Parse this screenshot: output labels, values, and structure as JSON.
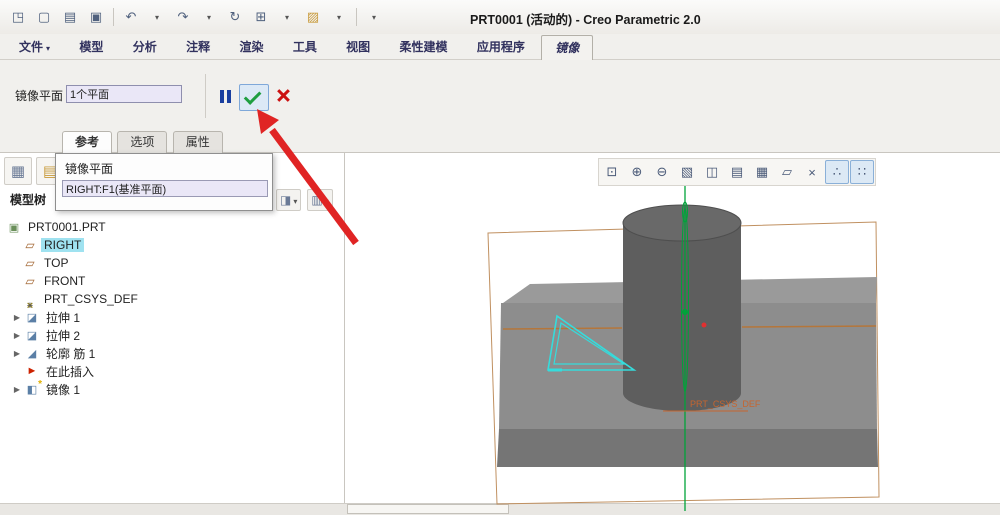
{
  "colors": {
    "check_green": "#1f9e40",
    "cancel_red": "#cc1111",
    "pause_blue": "#1a3fa0",
    "selection_cyan": "#9fe2f0",
    "datum_orange": "#b5763a",
    "axis_green": "#00a33a",
    "sketch_cyan": "#35dcdc",
    "arrow_red": "#e02424"
  },
  "title_bar": {
    "title": "PRT0001 (活动的) - Creo Parametric 2.0",
    "icons": [
      {
        "name": "window-icon",
        "glyph": "◳"
      },
      {
        "name": "new-file-icon",
        "glyph": "▢"
      },
      {
        "name": "open-icon",
        "glyph": "▤"
      },
      {
        "name": "save-icon",
        "glyph": "▣"
      },
      {
        "name": "undo-icon",
        "glyph": "↶"
      },
      {
        "name": "redo-icon",
        "glyph": "↷"
      },
      {
        "name": "regenerate-icon",
        "glyph": "↻"
      },
      {
        "name": "windows-icon",
        "glyph": "⊞"
      },
      {
        "name": "recent-folder-icon",
        "glyph": "▨"
      }
    ]
  },
  "ribbon": {
    "tabs": [
      {
        "label": "文件",
        "active": false
      },
      {
        "label": "模型",
        "active": false
      },
      {
        "label": "分析",
        "active": false
      },
      {
        "label": "注释",
        "active": false
      },
      {
        "label": "渲染",
        "active": false
      },
      {
        "label": "工具",
        "active": false
      },
      {
        "label": "视图",
        "active": false
      },
      {
        "label": "柔性建模",
        "active": false
      },
      {
        "label": "应用程序",
        "active": false
      },
      {
        "label": "镜像",
        "active": true
      }
    ]
  },
  "dashboard": {
    "mirror_plane_label": "镜像平面",
    "mirror_plane_value": "1个平面"
  },
  "subtabs": [
    {
      "label": "参考",
      "active": true
    },
    {
      "label": "选项",
      "active": false
    },
    {
      "label": "属性",
      "active": false
    }
  ],
  "reference_panel": {
    "label": "镜像平面",
    "value": "RIGHT:F1(基准平面)"
  },
  "model_tree": {
    "title": "模型树",
    "items": [
      {
        "label": "PRT0001.PRT",
        "icon": "part"
      },
      {
        "label": "RIGHT",
        "icon": "datum-plane",
        "selected": true
      },
      {
        "label": "TOP",
        "icon": "datum-plane"
      },
      {
        "label": "FRONT",
        "icon": "datum-plane"
      },
      {
        "label": "PRT_CSYS_DEF",
        "icon": "csys"
      },
      {
        "label": "拉伸 1",
        "icon": "extrude",
        "expandable": true
      },
      {
        "label": "拉伸 2",
        "icon": "extrude",
        "expandable": true
      },
      {
        "label": "轮廓 筋 1",
        "icon": "rib",
        "expandable": true
      },
      {
        "label": "在此插入",
        "icon": "insert-here"
      },
      {
        "label": "镜像 1",
        "icon": "mirror",
        "expandable": true
      }
    ]
  },
  "graphics_toolbar": {
    "icons": [
      {
        "name": "refit-icon",
        "glyph": "⊡"
      },
      {
        "name": "zoom-in-icon",
        "glyph": "⊕"
      },
      {
        "name": "zoom-out-icon",
        "glyph": "⊖"
      },
      {
        "name": "repaint-icon",
        "glyph": "▧"
      },
      {
        "name": "display-style-icon",
        "glyph": "◫"
      },
      {
        "name": "saved-orientations-icon",
        "glyph": "▤"
      },
      {
        "name": "view-manager-icon",
        "glyph": "▦"
      },
      {
        "name": "datum-planes-toggle-icon",
        "glyph": "▱"
      },
      {
        "name": "datum-axes-toggle-icon",
        "glyph": "×"
      },
      {
        "name": "datum-points-toggle-icon",
        "glyph": "∴"
      },
      {
        "name": "csys-display-toggle-icon",
        "glyph": "∷"
      }
    ]
  },
  "graphics": {
    "csys_label": "PRT_CSYS_DEF"
  }
}
